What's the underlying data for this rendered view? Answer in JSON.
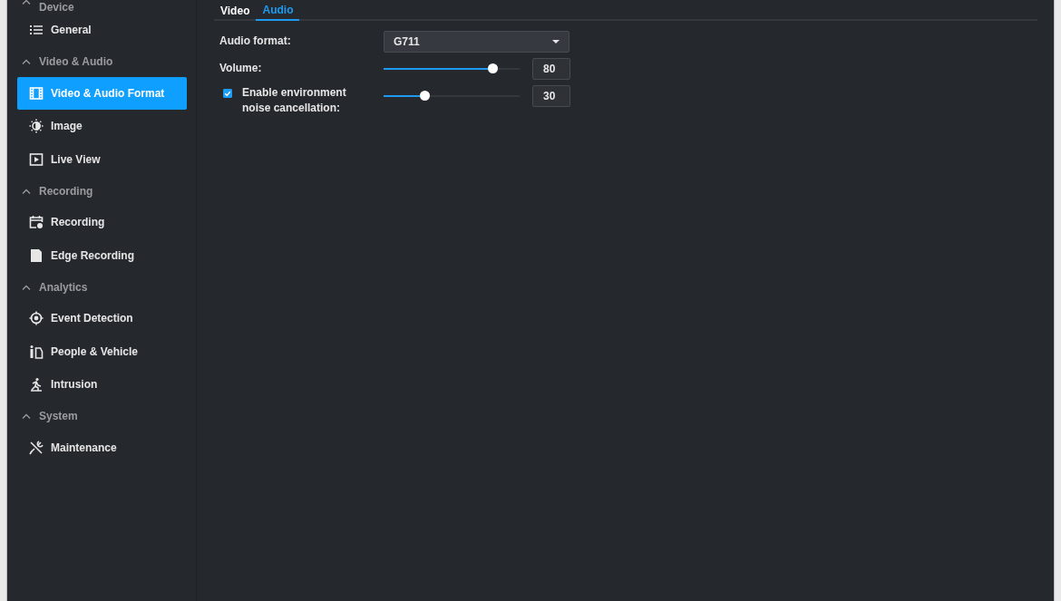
{
  "sidebar": {
    "sections": [
      {
        "title": "Device",
        "expanded": true,
        "items": [
          {
            "label": "General",
            "kind": "list",
            "selected": false
          }
        ]
      },
      {
        "title": "Video & Audio",
        "expanded": true,
        "items": [
          {
            "label": "Video & Audio Format",
            "kind": "film",
            "selected": true
          },
          {
            "label": "Image",
            "kind": "brightness",
            "selected": false
          },
          {
            "label": "Live View",
            "kind": "play",
            "selected": false
          }
        ]
      },
      {
        "title": "Recording",
        "expanded": true,
        "items": [
          {
            "label": "Recording",
            "kind": "calendar",
            "selected": false
          },
          {
            "label": "Edge Recording",
            "kind": "sd",
            "selected": false
          }
        ]
      },
      {
        "title": "Analytics",
        "expanded": true,
        "items": [
          {
            "label": "Event Detection",
            "kind": "target",
            "selected": false
          },
          {
            "label": "People & Vehicle",
            "kind": "person",
            "selected": false
          },
          {
            "label": "Intrusion",
            "kind": "runner",
            "selected": false
          }
        ]
      },
      {
        "title": "System",
        "expanded": true,
        "items": [
          {
            "label": "Maintenance",
            "kind": "tools",
            "selected": false
          }
        ]
      }
    ]
  },
  "tabs": [
    {
      "label": "Video",
      "selected": false
    },
    {
      "label": "Audio",
      "selected": true
    }
  ],
  "settings": [
    {
      "kind": "select",
      "label": "Audio format:",
      "value": "G711"
    },
    {
      "kind": "slider",
      "label": "Volume:",
      "level": 0.8,
      "reading": "80"
    },
    {
      "kind": "check-slider",
      "label": "Enable environment noise cancellation:",
      "checked": true,
      "level": 0.3,
      "reading": "30"
    }
  ]
}
